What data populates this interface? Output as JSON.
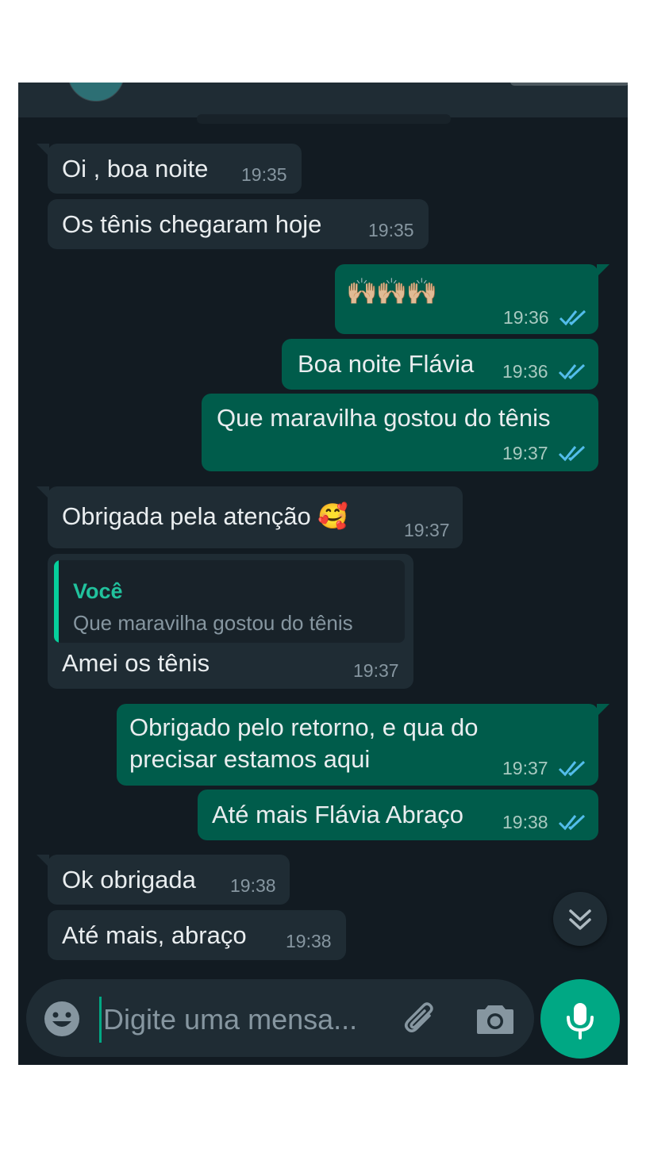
{
  "chat": {
    "messages": [
      {
        "dir": "in",
        "text": "Oi , boa noite",
        "time": "19:35"
      },
      {
        "dir": "in",
        "text": "Os tênis chegaram hoje",
        "time": "19:35"
      },
      {
        "dir": "out",
        "text": "🙌🏼🙌🏼🙌🏼",
        "time": "19:36",
        "status": "read"
      },
      {
        "dir": "out",
        "text": "Boa noite Flávia",
        "time": "19:36",
        "status": "read"
      },
      {
        "dir": "out",
        "text": "Que maravilha gostou do tênis",
        "time": "19:37",
        "status": "read"
      },
      {
        "dir": "in",
        "text": "Obrigada pela atenção 🥰",
        "time": "19:37"
      },
      {
        "dir": "in",
        "text": "Amei os tênis",
        "time": "19:37",
        "quote": {
          "author": "Você",
          "text": "Que maravilha gostou do tênis"
        }
      },
      {
        "dir": "out",
        "text": "Obrigado pelo retorno, e qua do\nprecisar estamos aqui",
        "time": "19:37",
        "status": "read"
      },
      {
        "dir": "out",
        "text": "Até mais Flávia Abraço",
        "time": "19:38",
        "status": "read"
      },
      {
        "dir": "in",
        "text": "Ok obrigada",
        "time": "19:38"
      },
      {
        "dir": "in",
        "text": "Até mais, abraço",
        "time": "19:38"
      }
    ]
  },
  "composer": {
    "placeholder": "Digite uma mensa..."
  },
  "icons": {
    "emoji": "smiley-icon",
    "attach": "paperclip-icon",
    "camera": "camera-icon",
    "mic": "microphone-icon",
    "scroll": "double-chevron-down-icon",
    "read_ticks": "double-check-icon"
  },
  "colors": {
    "background": "#121b22",
    "incoming": "#1f2c34",
    "outgoing": "#005c4b",
    "accent": "#00a884",
    "read_ticks": "#53bdeb",
    "quote_author": "#21c29d"
  }
}
